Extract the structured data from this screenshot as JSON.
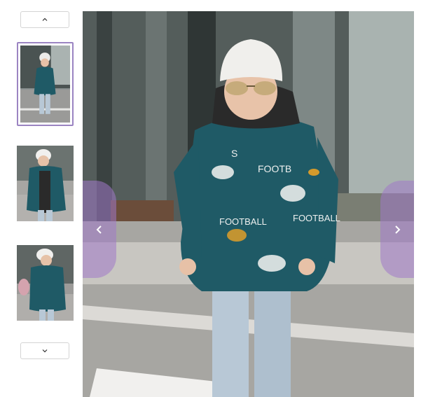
{
  "gallery": {
    "thumbnails": [
      {
        "alt": "thumbnail-1",
        "selected": true
      },
      {
        "alt": "thumbnail-2",
        "selected": false
      },
      {
        "alt": "thumbnail-3",
        "selected": false
      }
    ],
    "nav_up_icon": "chevron-up-icon",
    "nav_down_icon": "chevron-down-icon",
    "prev_icon": "chevron-left-icon",
    "next_icon": "chevron-right-icon",
    "jacket_print_text": [
      "FOOTBALL",
      "FOOTBALL",
      "S",
      "FOOTB"
    ]
  },
  "colors": {
    "arrow_bg": "#a078c8",
    "selected_border": "#9b84c2",
    "jacket": "#1f5a66",
    "jeans": "#b8c8d6"
  }
}
